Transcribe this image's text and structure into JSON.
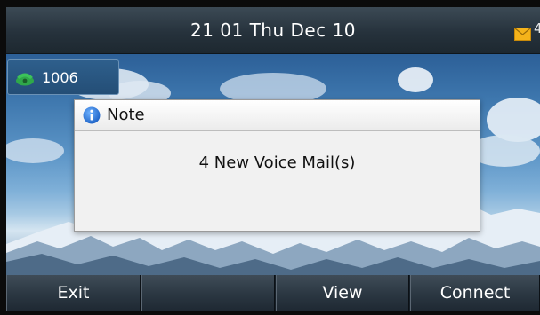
{
  "status_bar": {
    "datetime": "21 01 Thu Dec 10",
    "mail_icon": "envelope-icon",
    "mail_count": "4",
    "accent_color": "#f5b31a"
  },
  "account": {
    "label": "1006",
    "icon": "phone-handset-icon",
    "icon_color": "#2fa84a"
  },
  "dialog": {
    "title": "Note",
    "icon": "info-icon",
    "message": "4 New Voice Mail(s)"
  },
  "softkeys": [
    {
      "label": "Exit"
    },
    {
      "label": ""
    },
    {
      "label": "View"
    },
    {
      "label": "Connect"
    }
  ]
}
